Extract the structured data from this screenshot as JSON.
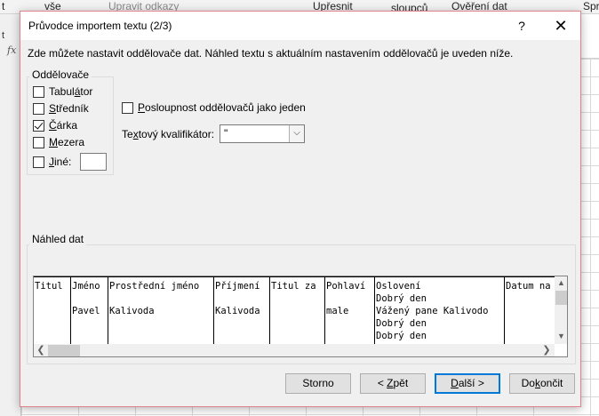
{
  "background": {
    "ribbon_items": [
      "t",
      "vše",
      "Upravit odkazy",
      "Upřesnit",
      "sloupců",
      "Ověření dat",
      "Spr"
    ],
    "strip_label": "t",
    "fx_label": "fx"
  },
  "dialog": {
    "title": "Průvodce importem textu (2/3)",
    "help_label": "?",
    "close_label": "✕",
    "intro": "Zde můžete nastavit oddělovače dat. Náhled textu s aktuálním nastavením oddělovačů je uveden níže.",
    "delimiters": {
      "legend": "Oddělovače",
      "items": [
        {
          "pre": "Tabul",
          "key": "á",
          "post": "tor",
          "checked": false
        },
        {
          "pre": "",
          "key": "S",
          "post": "tředník",
          "checked": false
        },
        {
          "pre": "",
          "key": "Č",
          "post": "árka",
          "checked": true
        },
        {
          "pre": "",
          "key": "M",
          "post": "ezera",
          "checked": false
        },
        {
          "pre": "",
          "key": "J",
          "post": "iné:",
          "checked": false
        }
      ],
      "other_value": ""
    },
    "consecutive": {
      "pre": "",
      "key": "P",
      "post": "osloupnost oddělovačů jako jeden",
      "checked": false
    },
    "qualifier": {
      "pre": "Te",
      "key": "x",
      "post": "tový kvalifikátor:",
      "value": "\"",
      "dropdown_icon": "chevron-down-icon"
    },
    "preview": {
      "legend": "Náhled dat",
      "columns": [
        {
          "cells": [
            "Titul",
            "",
            "",
            "",
            ""
          ]
        },
        {
          "cells": [
            "Jméno",
            "",
            "Pavel",
            "",
            ""
          ]
        },
        {
          "cells": [
            "Prostřední jméno",
            "",
            "Kalivoda",
            "",
            ""
          ]
        },
        {
          "cells": [
            "Příjmení",
            "",
            "Kalivoda",
            "",
            ""
          ]
        },
        {
          "cells": [
            "Titul za",
            "",
            "",
            "",
            ""
          ]
        },
        {
          "cells": [
            "Pohlaví",
            "",
            "male",
            "",
            ""
          ]
        },
        {
          "cells": [
            "Oslovení",
            "Dobrý den",
            "Vážený pane Kalivodo",
            "Dobrý den",
            "Dobrý den"
          ]
        },
        {
          "cells": [
            "Datum na",
            "",
            "",
            "",
            ""
          ]
        }
      ]
    },
    "buttons": {
      "cancel": "Storno",
      "back": {
        "pre": "< ",
        "key": "Z",
        "post": "pět"
      },
      "next": {
        "pre": "",
        "key": "D",
        "post": "alší >"
      },
      "finish": {
        "pre": "Do",
        "key": "k",
        "post": "ončit"
      }
    }
  }
}
